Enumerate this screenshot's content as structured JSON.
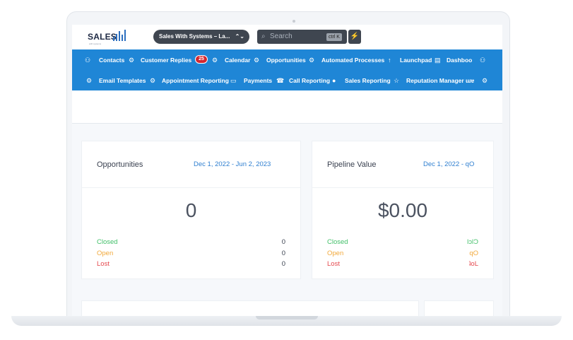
{
  "topbar": {
    "logo_text": "SALES",
    "logo_sub": "with systems",
    "account_label": "Sales With Systems – La...",
    "account_chevron": "⌃⌄",
    "search_placeholder": "Search",
    "search_shortcut": "ctrl K",
    "search_icon": "search-icon",
    "bolt_icon": "bolt-icon"
  },
  "nav": {
    "row1": [
      {
        "label": "Contacts",
        "icon": "users-icon"
      },
      {
        "label": "Customer Replies",
        "icon": "gear-icon",
        "badge": "25"
      },
      {
        "label": "Calendar",
        "icon": "gear-icon"
      },
      {
        "label": "Opportunities",
        "icon": "gear-icon"
      },
      {
        "label": "Automated Processes",
        "icon": "gear-icon"
      },
      {
        "label": "Launchpad",
        "icon": "rocket-icon"
      },
      {
        "label": "Dashboo",
        "icon": "database-icon"
      }
    ],
    "row2": [
      {
        "label": "Email Templates",
        "icon": "gear-icon"
      },
      {
        "label": "Appointment Reporting",
        "icon": "gear-icon"
      },
      {
        "label": "Payments",
        "icon": "card-icon"
      },
      {
        "label": "Call Reporting",
        "icon": "phone-icon"
      },
      {
        "label": "Sales Reporting",
        "icon": "chart-icon"
      },
      {
        "label": "Reputation Manager",
        "icon": "star-icon"
      },
      {
        "label": "ɯɐ",
        "icon": "gear-icon"
      }
    ]
  },
  "cards": {
    "opportunities": {
      "title": "Opportunities",
      "range": "Dec 1, 2022 - Jun 2, 2023",
      "value": "0",
      "stats": [
        {
          "label": "Closed",
          "value": "0"
        },
        {
          "label": "Open",
          "value": "0"
        },
        {
          "label": "Lost",
          "value": "0"
        }
      ]
    },
    "pipeline": {
      "title": "Pipeline Value",
      "range": "Dec 1, 2022 - qO",
      "value": "$0.00",
      "stats": [
        {
          "label": "Closed",
          "value": "lɔlƆ"
        },
        {
          "label": "Open",
          "value": "qO"
        },
        {
          "label": "Lost",
          "value": "ʇoL"
        }
      ]
    }
  },
  "colors": {
    "nav_bg": "#1f86d6",
    "closed": "#43c06a",
    "open": "#f2a93b",
    "lost": "#e5484d",
    "range_link": "#2f7fd0",
    "badge": "#d3262f"
  }
}
